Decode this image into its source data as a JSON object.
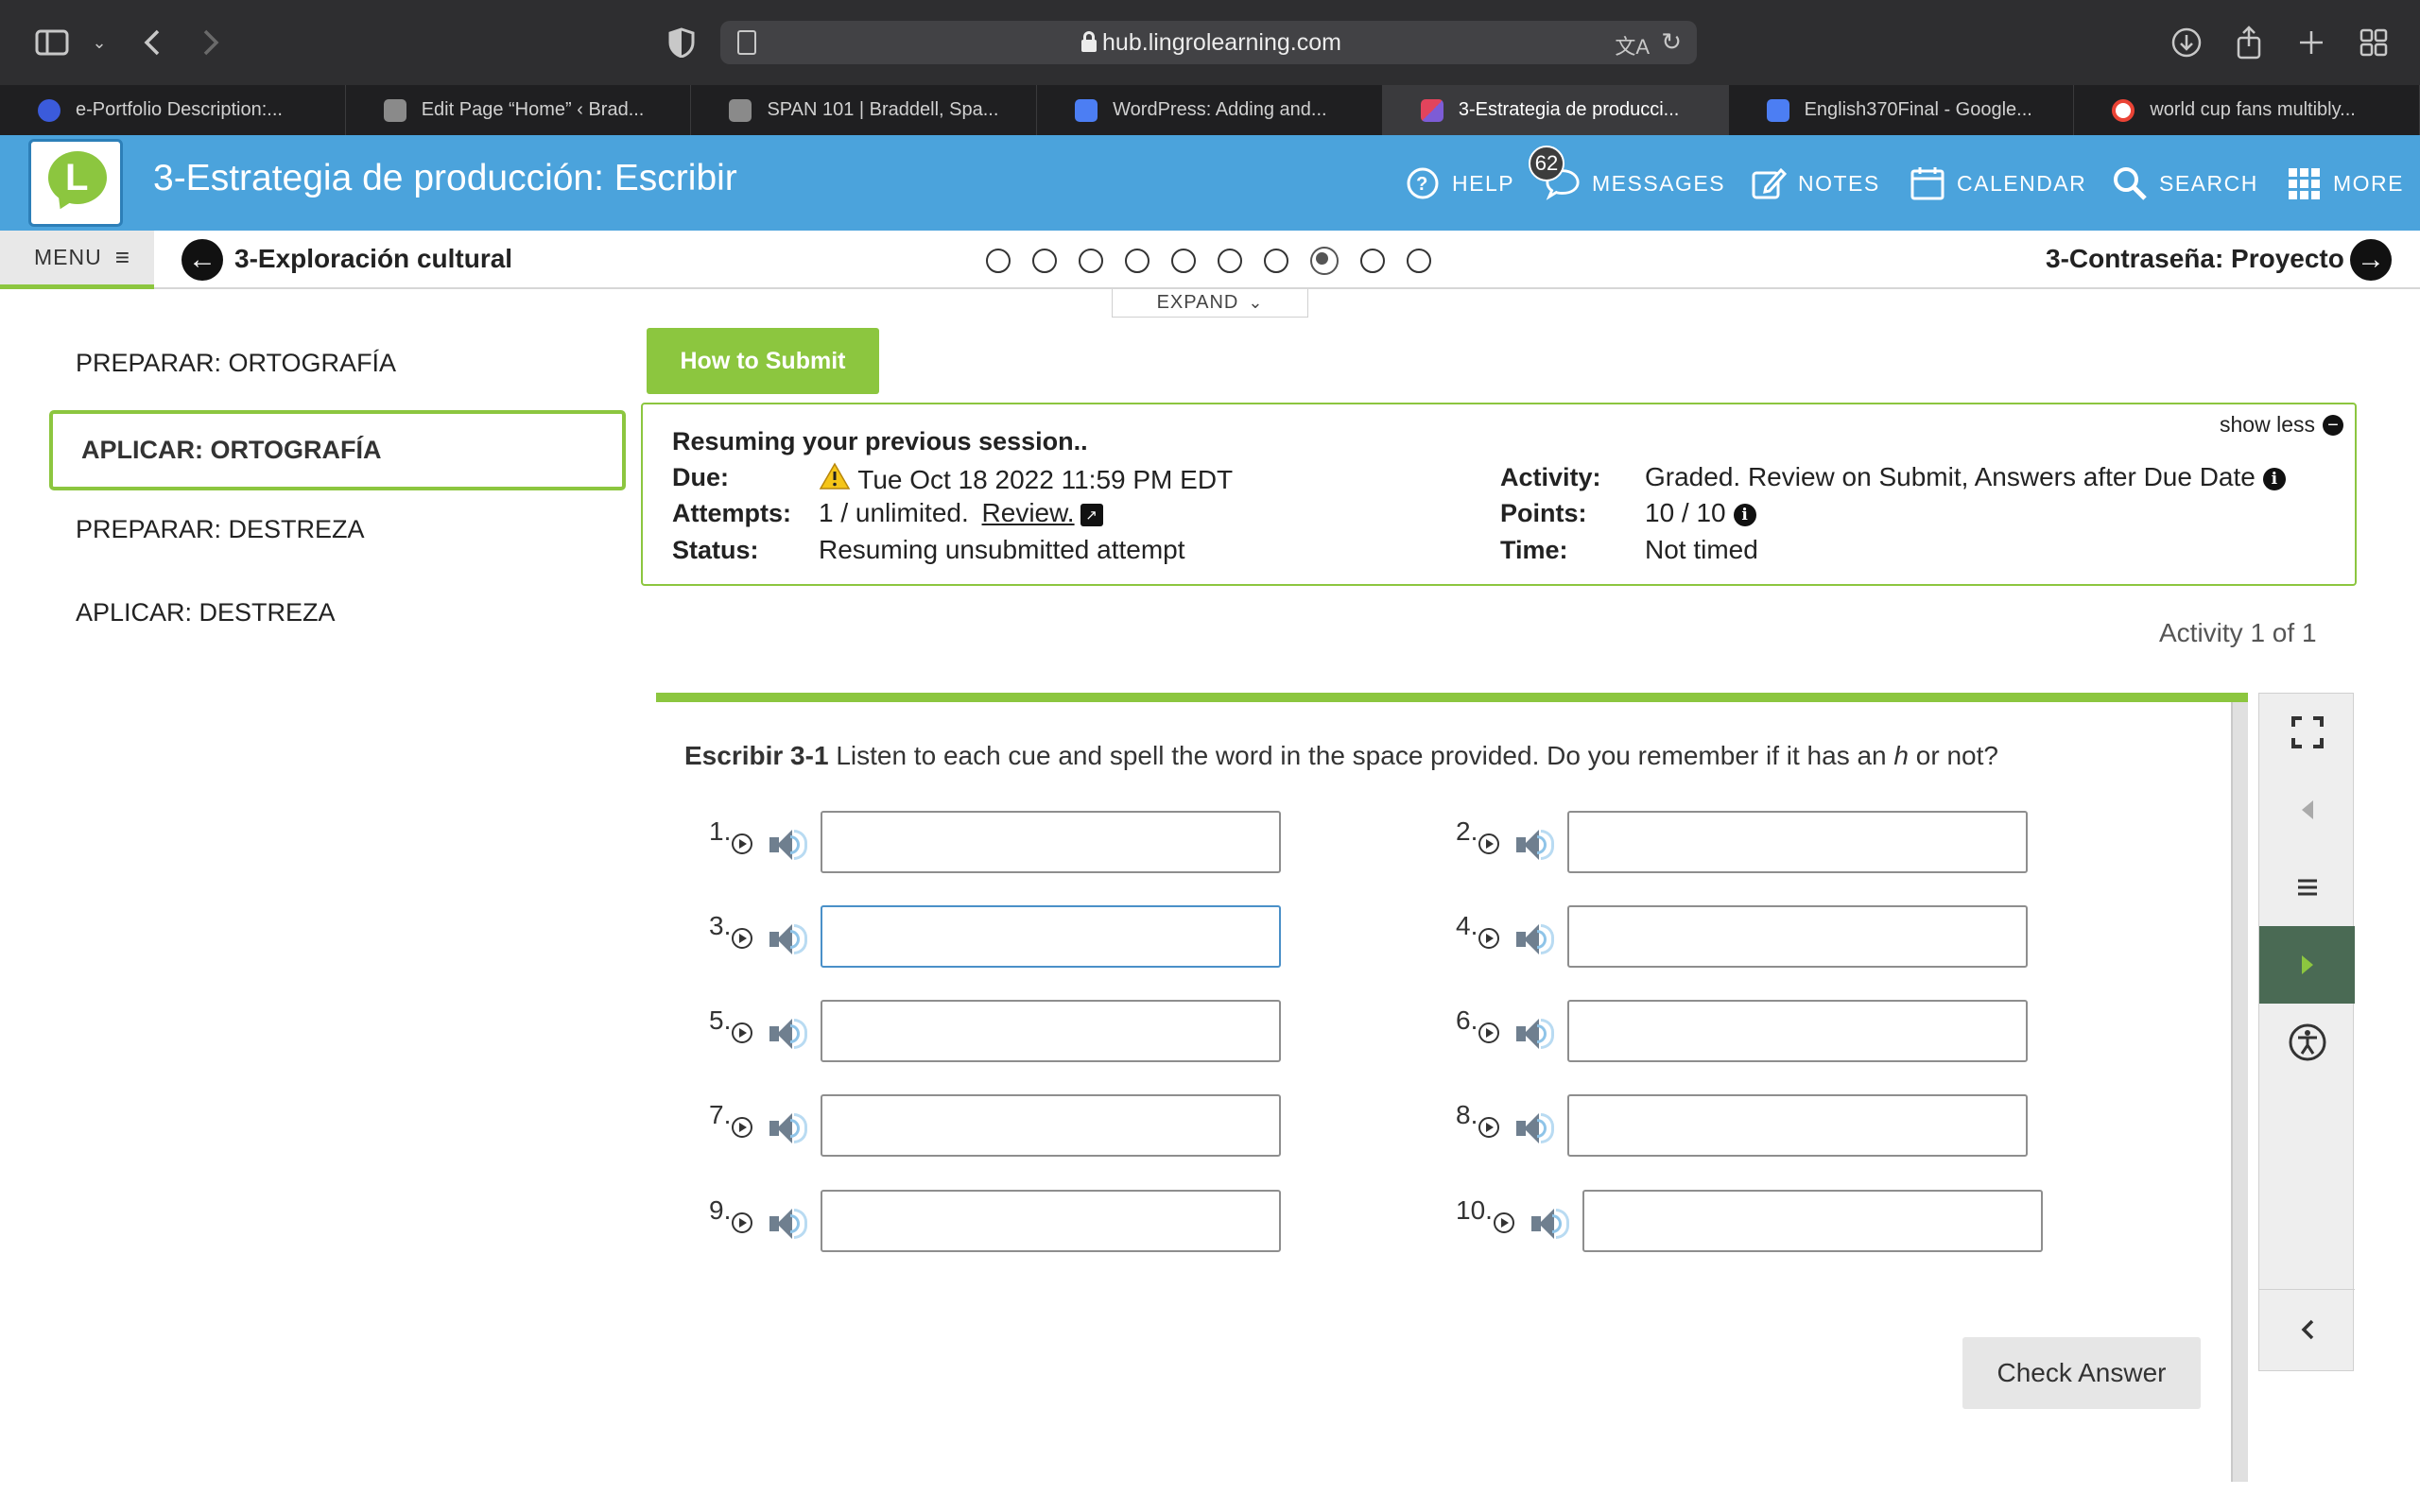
{
  "browser": {
    "url": "hub.lingrolearning.com",
    "tabs": [
      {
        "label": "e-Portfolio Description:...",
        "favicon_color": "#3b5bdb"
      },
      {
        "label": "Edit Page “Home” ‹ Brad...",
        "favicon_color": "#8a8a8a"
      },
      {
        "label": "SPAN 101 | Braddell, Spa...",
        "favicon_color": "#8a8a8a"
      },
      {
        "label": "WordPress: Adding and...",
        "favicon_color": "#4c7ef3"
      },
      {
        "label": "3-Estrategia de producci...",
        "favicon_color": "#e2445c",
        "active": true
      },
      {
        "label": "English370Final - Google...",
        "favicon_color": "#4c7ef3"
      },
      {
        "label": "world cup fans multibly...",
        "favicon_color": "#ffffff"
      }
    ]
  },
  "header": {
    "title": "3-Estrategia de producción: Escribir",
    "logo_letter": "L",
    "nav": {
      "help": "HELP",
      "messages": "MESSAGES",
      "messages_count": "62",
      "notes": "NOTES",
      "calendar": "CALENDAR",
      "search": "SEARCH",
      "more": "MORE"
    }
  },
  "subnav": {
    "menu_label": "MENU",
    "prev_label": "3-Exploración cultural",
    "next_label": "3-Contraseña: Proyecto",
    "progress_total": 10,
    "progress_current_index": 7,
    "expand_label": "EXPAND"
  },
  "sidebar": {
    "items": [
      {
        "label": "PREPARAR: ORTOGRAFÍA",
        "active": false
      },
      {
        "label": "APLICAR: ORTOGRAFÍA",
        "active": true
      },
      {
        "label": "PREPARAR: DESTREZA",
        "active": false
      },
      {
        "label": "APLICAR: DESTREZA",
        "active": false
      }
    ]
  },
  "submit_button": "How to Submit",
  "session": {
    "title": "Resuming your previous session..",
    "show_less": "show less",
    "due_key": "Due:",
    "due_val": "Tue Oct 18 2022 11:59 PM EDT",
    "attempts_key": "Attempts:",
    "attempts_val": "1 / unlimited.",
    "attempts_link": "Review.",
    "status_key": "Status:",
    "status_val": "Resuming unsubmitted attempt",
    "activity_key": "Activity:",
    "activity_val": "Graded. Review on Submit, Answers after Due Date",
    "points_key": "Points:",
    "points_val": "10 / 10",
    "time_key": "Time:",
    "time_val": "Not timed"
  },
  "activity_counter": "Activity 1 of 1",
  "activity": {
    "label": "Escribir 3-1",
    "instruction_a": "Listen to each cue and spell the word in the space provided. Do you remember if it has an",
    "instruction_italic": "h",
    "instruction_b": "or not?",
    "questions": [
      {
        "num": "1.",
        "value": ""
      },
      {
        "num": "2.",
        "value": ""
      },
      {
        "num": "3.",
        "value": ""
      },
      {
        "num": "4.",
        "value": ""
      },
      {
        "num": "5.",
        "value": ""
      },
      {
        "num": "6.",
        "value": ""
      },
      {
        "num": "7.",
        "value": ""
      },
      {
        "num": "8.",
        "value": ""
      },
      {
        "num": "9.",
        "value": ""
      },
      {
        "num": "10.",
        "value": ""
      }
    ],
    "check_answer": "Check Answer"
  },
  "colors": {
    "header_blue": "#4ba3dc",
    "accent_green": "#8cc63f",
    "browser_dark": "#2e2e30"
  }
}
